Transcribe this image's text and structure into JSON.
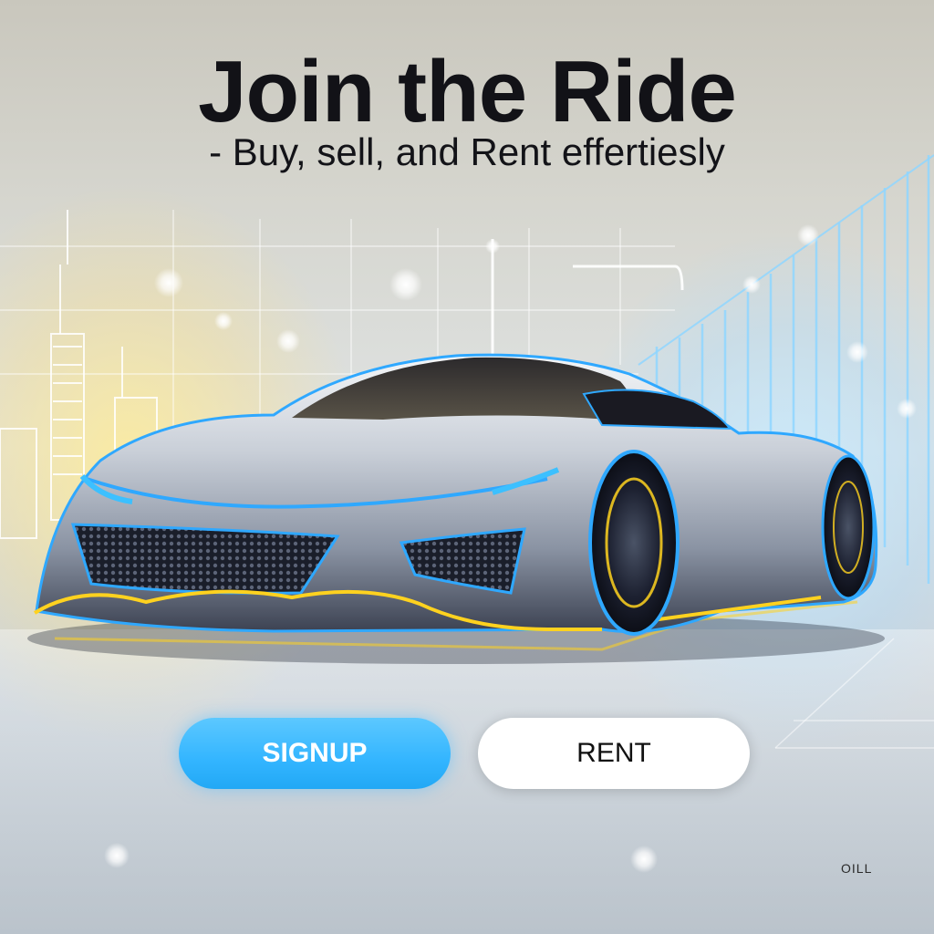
{
  "hero": {
    "headline": "Join the Ride",
    "subheadline": "- Buy, sell, and Rent effertiesly"
  },
  "actions": {
    "signup_label": "SIGNUP",
    "rent_label": "RENT"
  },
  "footer": {
    "watermark": "OILL"
  },
  "colors": {
    "signup_button": "#33b5ff",
    "rent_button": "#ffffff",
    "car_neon_blue": "#2fa8ff",
    "car_neon_yellow": "#ffd21f",
    "headline_text": "#121217"
  },
  "icons": {
    "vehicle": "car-illustration"
  }
}
